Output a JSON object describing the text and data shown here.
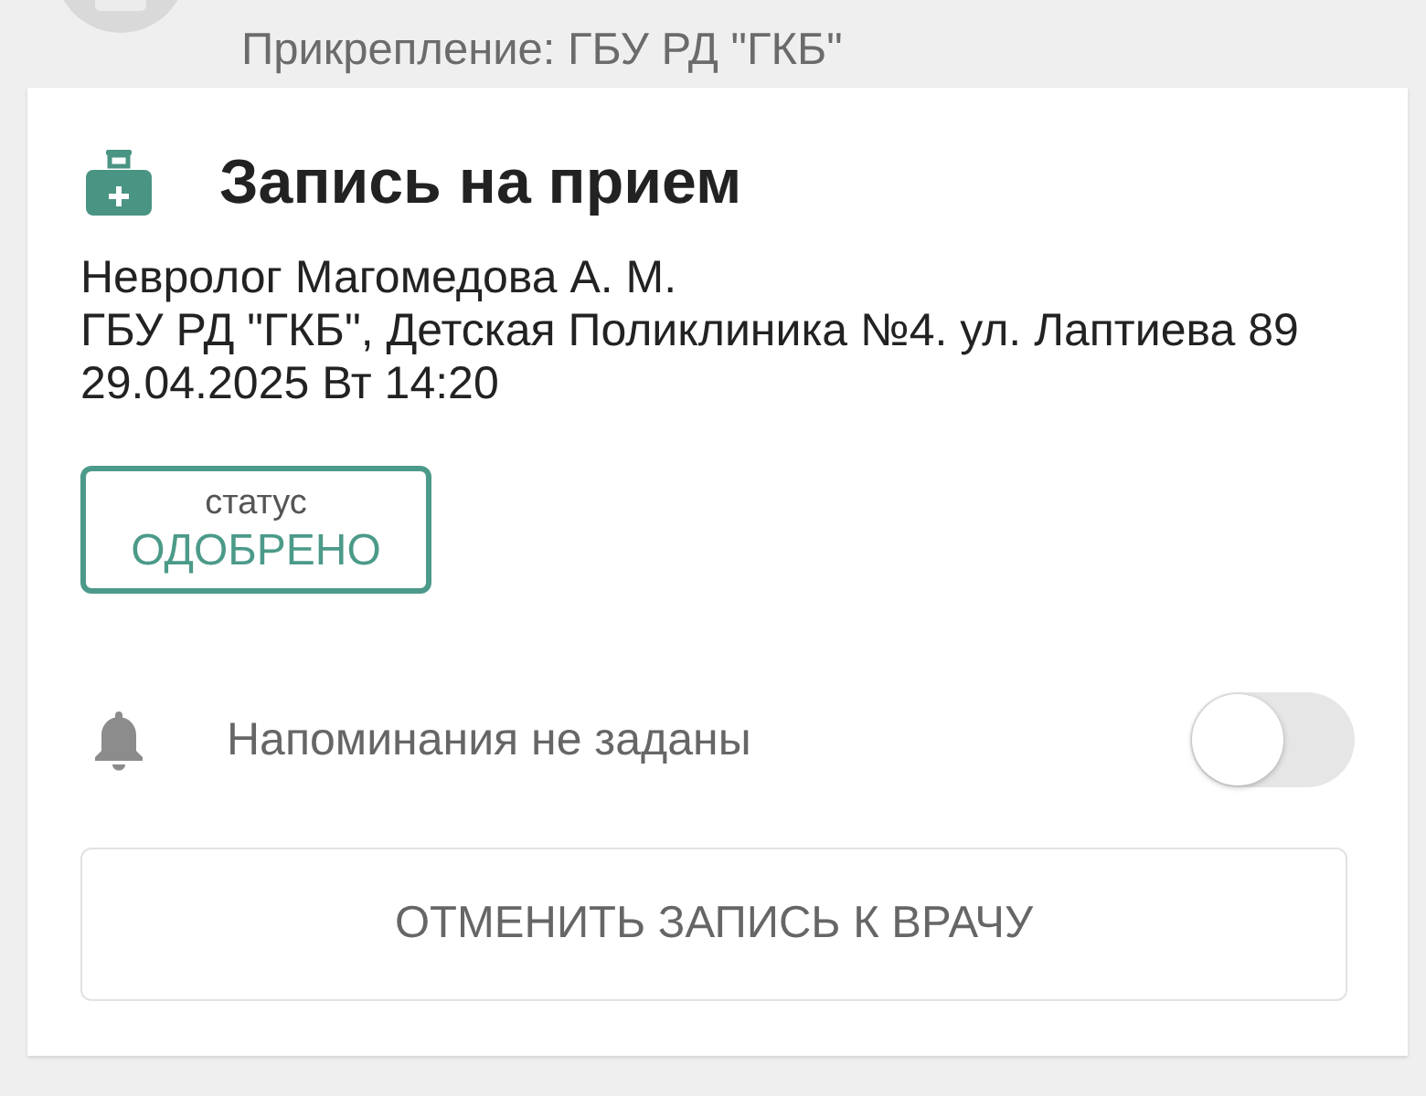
{
  "header": {
    "attachment": "Прикрепление: ГБУ РД \"ГКБ\""
  },
  "appointment": {
    "title": "Запись на прием",
    "details": [
      "Невролог Магомедова А. М.",
      "ГБУ РД \"ГКБ\", Детская Поликлиника №4. ул. Лаптиева 89",
      "29.04.2025 Вт 14:20"
    ],
    "status": {
      "label": "статус",
      "value": "ОДОБРЕНО"
    },
    "reminder": {
      "label": "Напоминания не заданы",
      "on": false
    },
    "cancel_button": "ОТМЕНИТЬ ЗАПИСЬ К ВРАЧУ"
  }
}
